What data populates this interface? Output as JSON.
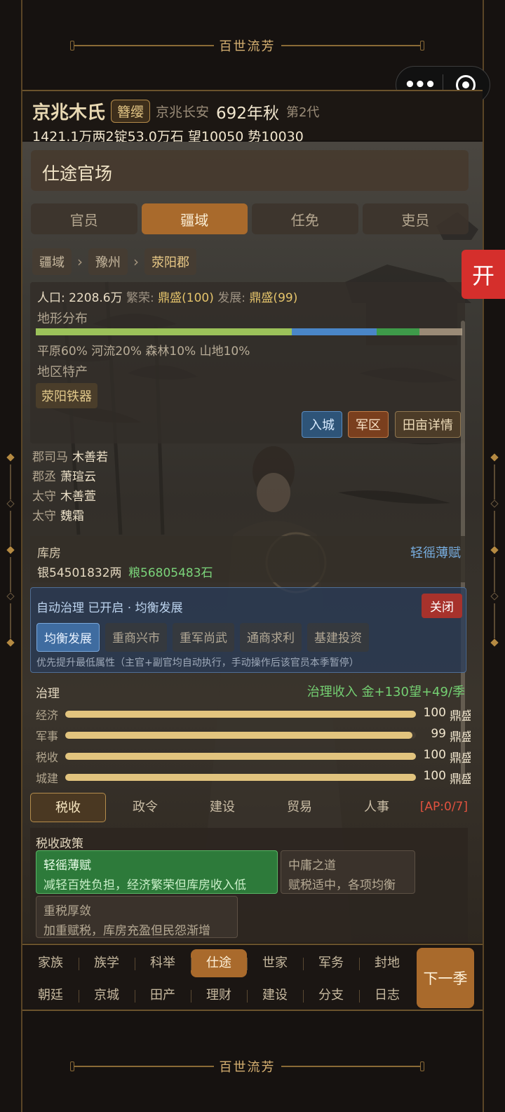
{
  "banner_top": "百世流芳",
  "banner_bottom": "百世流芳",
  "capsule": {
    "more": "•••",
    "close": "close-target"
  },
  "header": {
    "family": "京兆木氏",
    "rank": "簪缨",
    "location": "京兆长安",
    "year": "692年秋",
    "generation": "第2代",
    "resources": "1421.1万两2锭53.0万石  望10050 势10030"
  },
  "page_title": "仕途官场",
  "tabs": [
    "官员",
    "疆域",
    "任免",
    "吏员"
  ],
  "active_tab": "疆域",
  "breadcrumb": [
    "疆域",
    "豫州",
    "荥阳郡"
  ],
  "region": {
    "population_label": "人口: 2208.6万",
    "prosperity_label": "繁荣:",
    "prosperity_value": "鼎盛(100)",
    "development_label": "发展:",
    "development_value": "鼎盛(99)",
    "terrain_label": "地形分布",
    "terrain": [
      {
        "name": "平原",
        "percent": 60,
        "color": "#9cc25a"
      },
      {
        "name": "河流",
        "percent": 20,
        "color": "#4a86c7"
      },
      {
        "name": "森林",
        "percent": 10,
        "color": "#3e9a49"
      },
      {
        "name": "山地",
        "percent": 10,
        "color": "#9a8a76"
      }
    ],
    "terrain_text": "平原60% 河流20% 森林10% 山地10%",
    "specialty_label": "地区特产",
    "specialty": "荥阳铁器",
    "buttons": {
      "enter": "入城",
      "army": "军区",
      "fields": "田亩详情"
    }
  },
  "officials": [
    {
      "title": "郡司马",
      "name": "木善若"
    },
    {
      "title": "郡丞",
      "name": "萧瑄云"
    },
    {
      "title": "太守",
      "name": "木善萱"
    },
    {
      "title": "太守",
      "name": "魏霜"
    }
  ],
  "treasury": {
    "label": "库房",
    "policy_link": "轻徭薄赋",
    "silver": "银54501832两",
    "grain": "粮56805483石"
  },
  "auto_govern": {
    "title": "自动治理 已开启 · 均衡发展",
    "close": "关闭",
    "modes": [
      "均衡发展",
      "重商兴市",
      "重军尚武",
      "通商求利",
      "基建投资"
    ],
    "active_mode": "均衡发展",
    "note": "优先提升最低属性（主官+副官均自动执行，手动操作后该官员本季暂停）"
  },
  "governance": {
    "label": "治理",
    "income": "治理收入 金+130望+49/季",
    "stats": [
      {
        "name": "经济",
        "value": 100,
        "display": "100",
        "tier": "鼎盛"
      },
      {
        "name": "军事",
        "value": 99,
        "display": "99",
        "tier": "鼎盛"
      },
      {
        "name": "税收",
        "value": 100,
        "display": "100",
        "tier": "鼎盛"
      },
      {
        "name": "城建",
        "value": 100,
        "display": "100",
        "tier": "鼎盛"
      }
    ]
  },
  "sub_tabs": [
    "税收",
    "政令",
    "建设",
    "贸易",
    "人事"
  ],
  "active_sub_tab": "税收",
  "ap": "[AP:0/7]",
  "tax_policy": {
    "label": "税收政策",
    "options": [
      {
        "name": "轻徭薄赋",
        "desc": "减轻百姓负担，经济繁荣但库房收入低",
        "selected": true
      },
      {
        "name": "中庸之道",
        "desc": "赋税适中，各项均衡",
        "selected": false
      },
      {
        "name": "重税厚敛",
        "desc": "加重赋税，库房充盈但民怨渐增",
        "selected": false
      }
    ]
  },
  "nav": {
    "row1": [
      "家族",
      "族学",
      "科举",
      "仕途",
      "世家",
      "军务",
      "封地"
    ],
    "row2": [
      "朝廷",
      "京城",
      "田产",
      "理财",
      "建设",
      "分支",
      "日志"
    ],
    "active": "仕途",
    "next": "下一季"
  },
  "open_button": "开"
}
